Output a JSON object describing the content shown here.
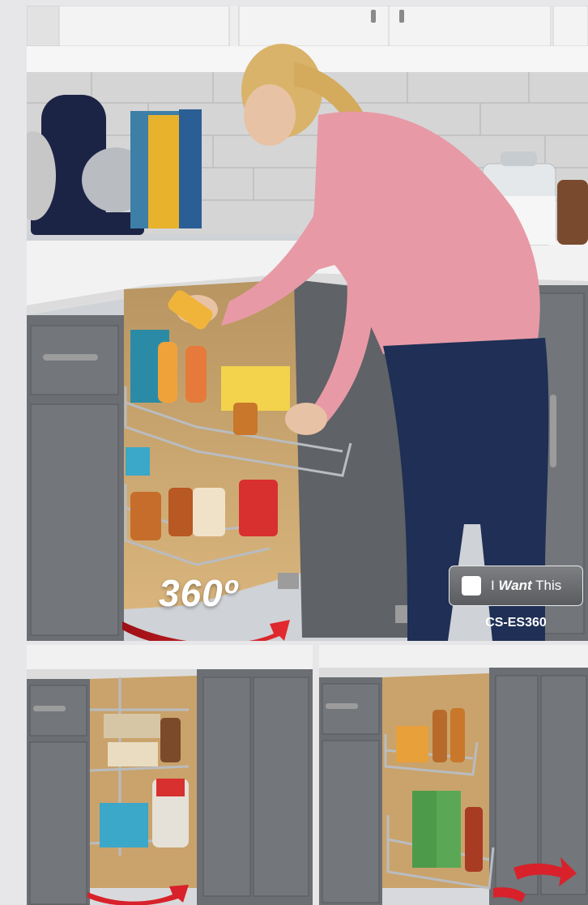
{
  "rotation_label": "360º",
  "want_button": {
    "prefix": "I",
    "emphasis": "Want",
    "suffix": "This"
  },
  "product_code": "CS-ES360",
  "colors": {
    "background": "#e7e7e9",
    "cabinet": "#6b6e72",
    "arrow_red": "#d8212a",
    "shirt": "#e79aa6",
    "jeans": "#1f2f55"
  }
}
